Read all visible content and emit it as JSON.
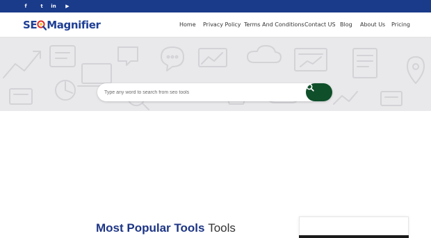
{
  "topbar": {
    "social": [
      {
        "name": "facebook",
        "glyph": "f"
      },
      {
        "name": "twitter",
        "glyph": "t"
      },
      {
        "name": "linkedin",
        "glyph": "in"
      },
      {
        "name": "youtube",
        "glyph": "▶"
      }
    ]
  },
  "logo": {
    "part1": "SE",
    "part2": "Magnifier"
  },
  "nav": {
    "items": [
      "Home",
      "Privacy Policy",
      "Terms And Conditions",
      "Contact US",
      "Blog",
      "About Us",
      "Pricing"
    ]
  },
  "search": {
    "placeholder": "Type any word to search from seo tools"
  },
  "section": {
    "title_part1": "Most Popular",
    "title_part2": "Tools",
    "title_part3": "Tools"
  },
  "colors": {
    "topbar": "#1a3a8a",
    "brand_blue": "#1f3f95",
    "search_button": "#0f4f2a"
  }
}
